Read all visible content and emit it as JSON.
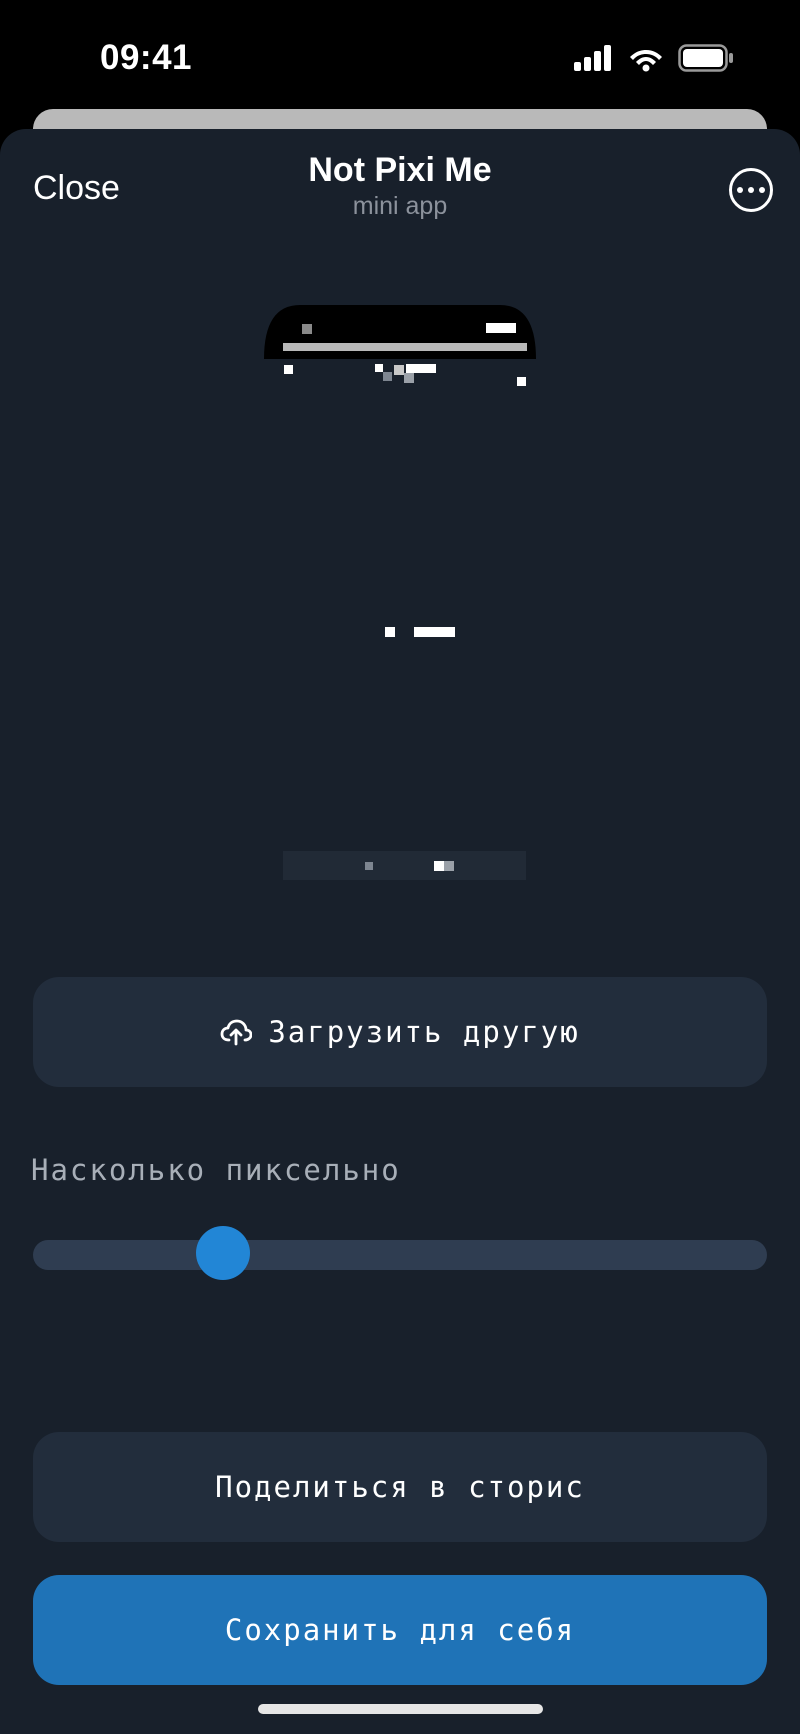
{
  "status_bar": {
    "time": "09:41"
  },
  "header": {
    "close_label": "Close",
    "title": "Not Pixi Me",
    "subtitle": "mini app"
  },
  "actions": {
    "upload_label": "Загрузить другую",
    "share_label": "Поделиться в сторис",
    "save_label": "Сохранить для себя"
  },
  "slider": {
    "label": "Насколько пиксельно",
    "value_fraction": 0.24
  },
  "colors": {
    "sheet_background": "#18202b",
    "secondary_button": "#222d3c",
    "primary_button": "#1f73b7",
    "slider_thumb": "#2286d6",
    "slider_track": "#2f3d51"
  },
  "icons": {
    "upload": "cloud-upload-icon",
    "more": "ellipsis-circle-icon",
    "signal": "signal-icon",
    "wifi": "wifi-icon",
    "battery": "battery-icon"
  }
}
